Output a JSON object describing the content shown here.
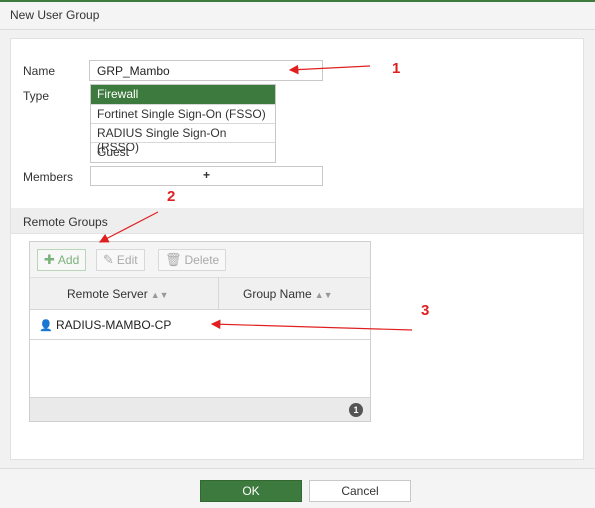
{
  "window": {
    "title": "New User Group"
  },
  "form": {
    "name_label": "Name",
    "name_value": "GRP_Mambo",
    "type_label": "Type",
    "type_options": [
      {
        "label": "Firewall",
        "selected": true
      },
      {
        "label": "Fortinet Single Sign-On (FSSO)",
        "selected": false
      },
      {
        "label": "RADIUS Single Sign-On (RSSO)",
        "selected": false
      },
      {
        "label": "Guest",
        "selected": false
      }
    ],
    "members_label": "Members",
    "members_add_symbol": "+"
  },
  "remote_groups": {
    "section_title": "Remote Groups",
    "toolbar": {
      "add_label": "Add",
      "edit_label": "Edit",
      "delete_label": "Delete"
    },
    "columns": [
      "Remote Server",
      "Group Name"
    ],
    "rows": [
      {
        "remote_server": "RADIUS-MAMBO-CP",
        "group_name": ""
      }
    ],
    "count": "1"
  },
  "footer": {
    "ok_label": "OK",
    "cancel_label": "Cancel"
  },
  "annotations": {
    "callout_1": "1",
    "callout_2": "2",
    "callout_3": "3"
  },
  "colors": {
    "accent_green": "#3d7a3d",
    "callout_red": "#e02020"
  },
  "icons": {
    "add": "plus-icon",
    "edit": "pencil-icon",
    "delete": "trash-icon",
    "sort": "sort-icon",
    "user": "user-server-icon"
  }
}
